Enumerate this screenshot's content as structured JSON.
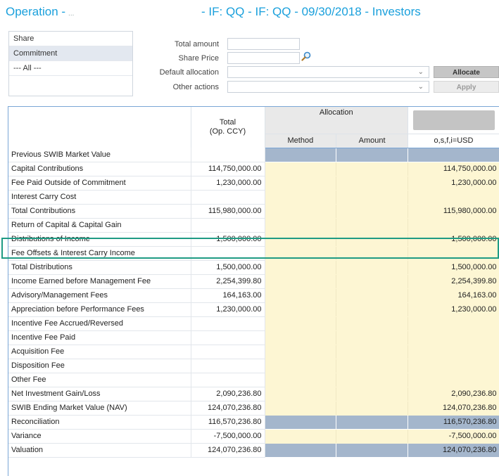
{
  "header": {
    "title_left": "Operation -",
    "title_left_suffix": "...",
    "title_right": "- IF: QQ - IF: QQ - 09/30/2018 - Investors"
  },
  "listbox": {
    "items": [
      {
        "label": "Share",
        "selected": false
      },
      {
        "label": "Commitment",
        "selected": true
      },
      {
        "label": "--- All ---",
        "selected": false
      }
    ]
  },
  "form": {
    "total_amount_label": "Total amount",
    "total_amount_value": "",
    "share_price_label": "Share Price",
    "share_price_value": "",
    "default_allocation_label": "Default allocation",
    "default_allocation_value": "",
    "other_actions_label": "Other actions",
    "other_actions_value": "",
    "allocate_label": "Allocate",
    "apply_label": "Apply"
  },
  "grid": {
    "headers": {
      "total_line1": "Total",
      "total_line2": "(Op. CCY)",
      "allocation": "Allocation",
      "method": "Method",
      "amount": "Amount",
      "currency": "o,s,f,i=USD"
    },
    "rows": [
      {
        "label": "Previous SWIB Market Value",
        "total": "",
        "usd": "",
        "style": "blue",
        "sep": false
      },
      {
        "label": "Capital Contributions",
        "total": "114,750,000.00",
        "usd": "114,750,000.00",
        "style": "yellow",
        "sep": true
      },
      {
        "label": "Fee Paid Outside of Commitment",
        "total": "1,230,000.00",
        "usd": "1,230,000.00",
        "style": "yellow",
        "sep": false
      },
      {
        "label": "Interest Carry Cost",
        "total": "",
        "usd": "",
        "style": "yellow",
        "sep": false
      },
      {
        "label": "Total Contributions",
        "total": "115,980,000.00",
        "usd": "115,980,000.00",
        "style": "yellow",
        "sep": false
      },
      {
        "label": "Return of Capital & Capital Gain",
        "total": "",
        "usd": "",
        "style": "yellow",
        "sep": true
      },
      {
        "label": "Distributions of Income",
        "total": "1,500,000.00",
        "usd": "1,500,000.00",
        "style": "yellow",
        "sep": false
      },
      {
        "label": "Fee Offsets & Interest Carry Income",
        "total": "",
        "usd": "",
        "style": "yellow",
        "sep": false
      },
      {
        "label": "Total Distributions",
        "total": "1,500,000.00",
        "usd": "1,500,000.00",
        "style": "yellow",
        "sep": false
      },
      {
        "label": "Income Earned before Management Fee",
        "total": "2,254,399.80",
        "usd": "2,254,399.80",
        "style": "yellow",
        "sep": true
      },
      {
        "label": "Advisory/Management Fees",
        "total": "164,163.00",
        "usd": "164,163.00",
        "style": "yellow",
        "sep": false
      },
      {
        "label": "Appreciation before Performance Fees",
        "total": "1,230,000.00",
        "usd": "1,230,000.00",
        "style": "yellow",
        "sep": false
      },
      {
        "label": "Incentive Fee Accrued/Reversed",
        "total": "",
        "usd": "",
        "style": "yellow",
        "sep": false
      },
      {
        "label": "Incentive Fee Paid",
        "total": "",
        "usd": "",
        "style": "yellow",
        "sep": false
      },
      {
        "label": "Acquisition Fee",
        "total": "",
        "usd": "",
        "style": "yellow",
        "sep": false
      },
      {
        "label": "Disposition Fee",
        "total": "",
        "usd": "",
        "style": "yellow",
        "sep": false
      },
      {
        "label": "Other Fee",
        "total": "",
        "usd": "",
        "style": "yellow",
        "sep": false
      },
      {
        "label": "Net Investment Gain/Loss",
        "total": "2,090,236.80",
        "usd": "2,090,236.80",
        "style": "yellow",
        "sep": false
      },
      {
        "label": "SWIB Ending Market Value (NAV)",
        "total": "124,070,236.80",
        "usd": "124,070,236.80",
        "style": "yellow",
        "sep": true
      },
      {
        "label": "Reconciliation",
        "total": "116,570,236.80",
        "usd": "116,570,236.80",
        "style": "blue",
        "sep": false
      },
      {
        "label": "Variance",
        "total": "-7,500,000.00",
        "usd": "-7,500,000.00",
        "style": "yellow",
        "sep": true
      },
      {
        "label": "Valuation",
        "total": "124,070,236.80",
        "usd": "124,070,236.80",
        "style": "blue",
        "sep": false
      }
    ]
  },
  "colors": {
    "accent_title": "#1aa0dc",
    "editable_cell": "#fdf6d3",
    "computed_cell": "#a4b6cc",
    "highlight_border": "#1f9b84"
  }
}
